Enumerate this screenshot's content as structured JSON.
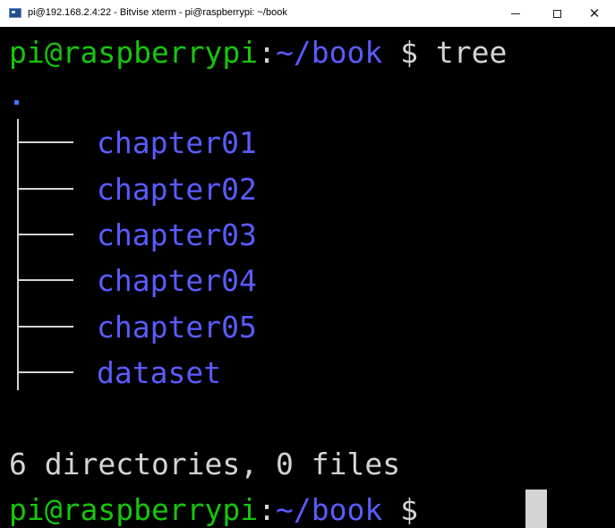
{
  "window": {
    "title": "pi@192.168.2.4:22 - Bitvise xterm - pi@raspberrypi: ~/book",
    "controls": {
      "minimize": "–",
      "maximize": "□",
      "close": "✕"
    }
  },
  "terminal": {
    "prompt_user_host": "pi@raspberrypi",
    "prompt_colon": ":",
    "prompt_path": "~/book",
    "prompt_symbol": " $ ",
    "command": "tree",
    "tree_root": ".",
    "directories": [
      "chapter01",
      "chapter02",
      "chapter03",
      "chapter04",
      "chapter05",
      "dataset"
    ],
    "summary": "6 directories, 0 files",
    "colors": {
      "background": "#000000",
      "prompt_green": "#16c60c",
      "directory_blue": "#5b5bff",
      "text_white": "#d4d4d4"
    }
  }
}
